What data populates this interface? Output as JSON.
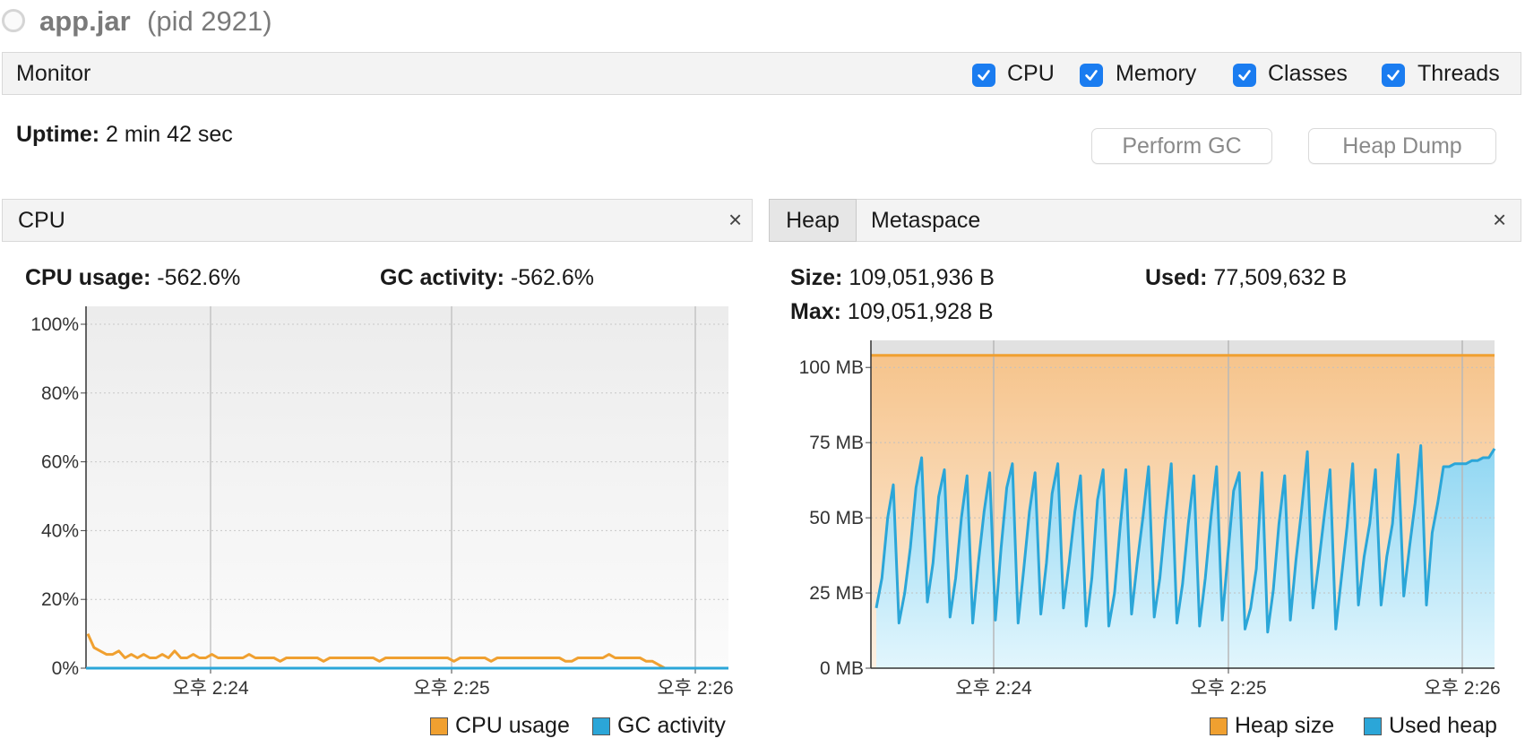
{
  "window": {
    "app_name": "app.jar",
    "pid_text": "(pid 2921)"
  },
  "monitor": {
    "title": "Monitor",
    "checkboxes": [
      {
        "label": "CPU",
        "checked": true
      },
      {
        "label": "Memory",
        "checked": true
      },
      {
        "label": "Classes",
        "checked": true
      },
      {
        "label": "Threads",
        "checked": true
      }
    ],
    "uptime_label": "Uptime:",
    "uptime_value": "2 min 42 sec",
    "perform_gc_label": "Perform GC",
    "heap_dump_label": "Heap Dump"
  },
  "cpu_panel": {
    "title": "CPU",
    "close_symbol": "×",
    "cpu_usage_label": "CPU usage:",
    "cpu_usage_value": "-562.6%",
    "gc_activity_label": "GC activity:",
    "gc_activity_value": "-562.6%",
    "legend": [
      {
        "name": "CPU usage",
        "color": "#f0a030"
      },
      {
        "name": "GC activity",
        "color": "#2ba6d8"
      }
    ]
  },
  "heap_panel": {
    "tabs": [
      "Heap",
      "Metaspace"
    ],
    "active_tab": "Heap",
    "close_symbol": "×",
    "size_label": "Size:",
    "size_value": "109,051,936 B",
    "used_label": "Used:",
    "used_value": "77,509,632 B",
    "max_label": "Max:",
    "max_value": "109,051,928 B",
    "legend": [
      {
        "name": "Heap size",
        "color": "#f0a030"
      },
      {
        "name": "Used heap",
        "color": "#2ba6d8"
      }
    ]
  },
  "chart_data": [
    {
      "type": "line",
      "y_ticks": [
        "0%",
        "20%",
        "40%",
        "60%",
        "80%",
        "100%"
      ],
      "ylim": [
        0,
        100
      ],
      "x_ticks": [
        "오후 2:24",
        "오후 2:25",
        "오후 2:26"
      ],
      "series": [
        {
          "name": "CPU usage",
          "color": "#f0a030",
          "values": [
            10,
            6,
            5,
            4,
            4,
            5,
            3,
            4,
            3,
            4,
            3,
            3,
            4,
            3,
            5,
            3,
            3,
            4,
            3,
            3,
            4,
            3,
            3,
            3,
            3,
            3,
            4,
            3,
            3,
            3,
            3,
            2,
            3,
            3,
            3,
            3,
            3,
            3,
            2,
            3,
            3,
            3,
            3,
            3,
            3,
            3,
            3,
            2,
            3,
            3,
            3,
            3,
            3,
            3,
            3,
            3,
            3,
            3,
            3,
            2,
            3,
            3,
            3,
            3,
            3,
            2,
            3,
            3,
            3,
            3,
            3,
            3,
            3,
            3,
            3,
            3,
            3,
            2,
            2,
            3,
            3,
            3,
            3,
            3,
            4,
            3,
            3,
            3,
            3,
            3,
            2,
            2,
            1,
            0
          ]
        },
        {
          "name": "GC activity",
          "color": "#2ba6d8",
          "values": [
            0,
            0
          ]
        }
      ]
    },
    {
      "type": "area",
      "y_ticks": [
        "0 MB",
        "25 MB",
        "50 MB",
        "75 MB",
        "100 MB"
      ],
      "ylim": [
        0,
        109
      ],
      "x_ticks": [
        "오후 2:24",
        "오후 2:25",
        "오후 2:26"
      ],
      "series": [
        {
          "name": "Heap size",
          "color": "#f0a030",
          "values": [
            104,
            104
          ]
        },
        {
          "name": "Used heap",
          "color": "#2ba6d8",
          "values": [
            20,
            30,
            50,
            61,
            15,
            25,
            40,
            60,
            70,
            22,
            35,
            57,
            66,
            17,
            30,
            50,
            64,
            15,
            35,
            52,
            65,
            16,
            40,
            60,
            68,
            15,
            33,
            52,
            65,
            18,
            35,
            58,
            68,
            20,
            35,
            52,
            64,
            14,
            30,
            56,
            66,
            14,
            25,
            47,
            66,
            18,
            35,
            50,
            67,
            17,
            30,
            50,
            68,
            15,
            28,
            48,
            64,
            14,
            30,
            50,
            67,
            16,
            38,
            59,
            65,
            13,
            20,
            33,
            65,
            12,
            26,
            48,
            64,
            16,
            36,
            53,
            72,
            20,
            35,
            51,
            66,
            13,
            30,
            47,
            68,
            21,
            37,
            48,
            66,
            21,
            37,
            48,
            71,
            24,
            40,
            55,
            74,
            21,
            45,
            55,
            67,
            67,
            68,
            68,
            68,
            69,
            69,
            70,
            70,
            73
          ]
        }
      ]
    }
  ]
}
